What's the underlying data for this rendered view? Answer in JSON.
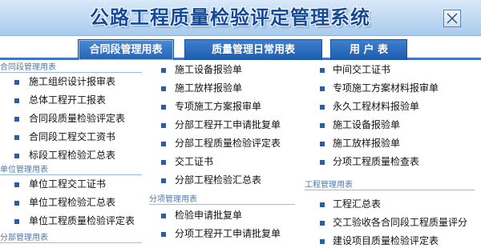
{
  "app": {
    "title": "公路工程质量检验评定管理系统"
  },
  "tabs": [
    {
      "label": "合同段管理用表"
    },
    {
      "label": "质量管理日常用表"
    },
    {
      "label": "用 户 表"
    }
  ],
  "col1": {
    "groups": [
      {
        "header": "合同段管理用表",
        "items": [
          "施工组织设计报审表",
          "总体工程开工报表",
          "合同段质量检验评定表",
          "合同段工程交工资书",
          "标段工程检验汇总表"
        ]
      },
      {
        "header": "单位管理用表",
        "items": [
          "单位工程交工证书",
          "单位工程检验汇总表",
          "单位工程质量检验评定表"
        ]
      },
      {
        "header": "分部管理用表",
        "items": []
      }
    ]
  },
  "col2": {
    "items1": [
      "施工设备报验单",
      "施工放样报验单",
      "专项施工方案报审单",
      "分部工程开工申请批复单",
      "分部工程质量检验评定表",
      "交工证书",
      "分部工程检验汇总表"
    ],
    "group_header": "分项管理用表",
    "items2": [
      "检验申请批复单",
      "分项工程开工申请批复单"
    ]
  },
  "col3": {
    "items1": [
      "中间交工证书",
      "专项施工方案材料报审单",
      "永久工程材料报验单",
      "施工设备报验单",
      "施工放样报验单",
      "分项工程质量检查表"
    ],
    "group_header": "工程管理用表",
    "items2": [
      "工程汇总表",
      "交工验收各合同段工程质量评分",
      "建设项目质量检验评定表"
    ]
  }
}
